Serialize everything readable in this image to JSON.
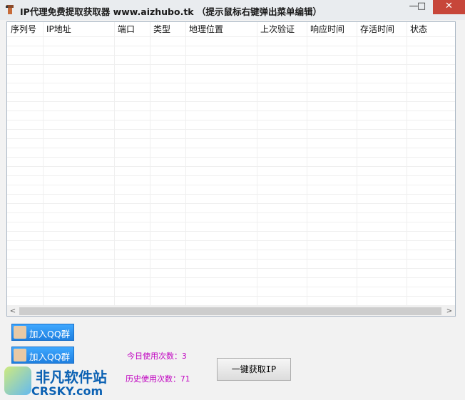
{
  "window": {
    "title": "IP代理免费提取获取器 www.aizhubo.tk （提示鼠标右键弹出菜单编辑）",
    "min_symbol": "—",
    "max_symbol": "□",
    "close_symbol": "✕"
  },
  "table": {
    "columns": [
      "序列号",
      "IP地址",
      "端口",
      "类型",
      "地理位置",
      "上次验证",
      "响应时间",
      "存活时间",
      "状态"
    ],
    "rows": []
  },
  "scrollbar": {
    "left_arrow": "<",
    "right_arrow": ">"
  },
  "buttons": {
    "join_qq_1": "加入QQ群",
    "join_qq_2": "加入QQ群",
    "fetch_ip": "一键获取IP"
  },
  "stats": {
    "today_label": "今日使用次数：",
    "today_value": "3",
    "history_label": "历史使用次数：",
    "history_value": "71"
  },
  "watermark": {
    "text": "非凡软件站",
    "sub": "CRSKY.com"
  }
}
